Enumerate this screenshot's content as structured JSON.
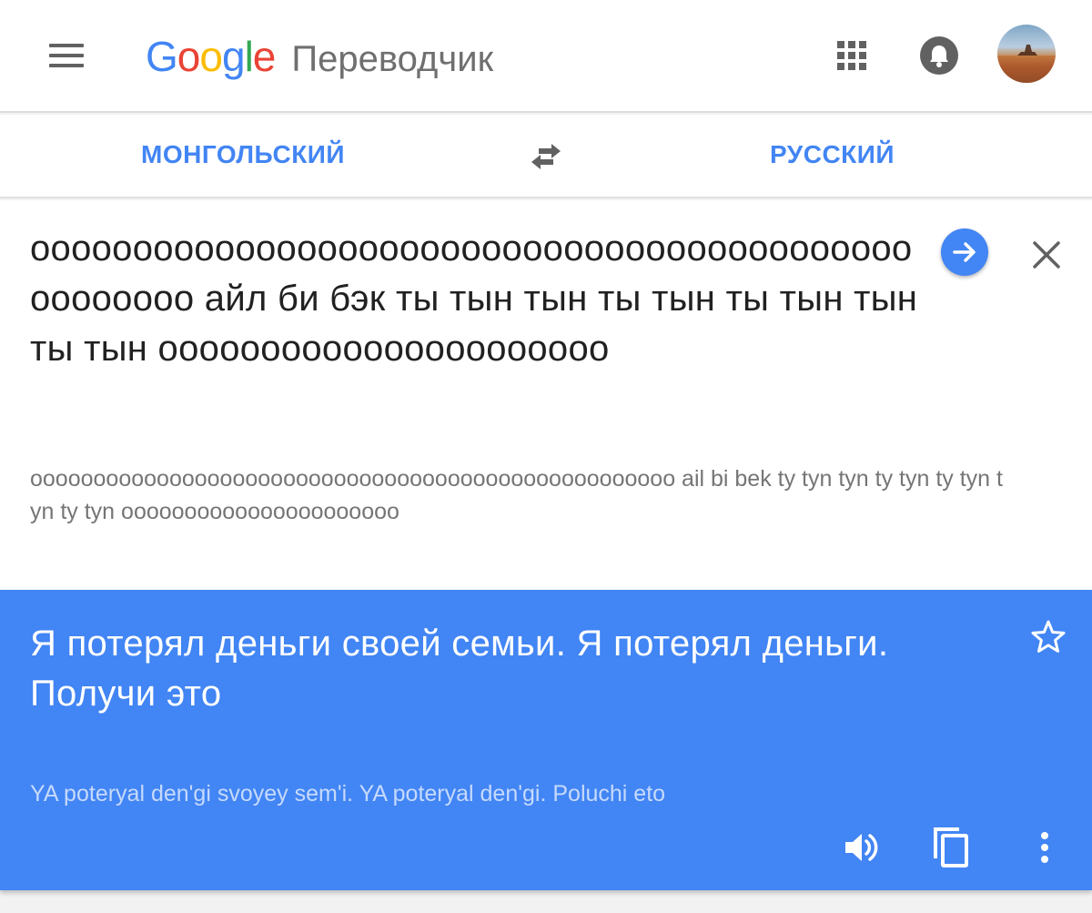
{
  "header": {
    "logo": {
      "letters": [
        "G",
        "o",
        "o",
        "g",
        "l",
        "e"
      ]
    },
    "app_title": "Переводчик",
    "icons": {
      "menu": "menu-icon",
      "apps": "apps-grid-icon",
      "notifications": "bell-icon",
      "avatar": "user-avatar"
    }
  },
  "languages": {
    "source": "МОНГОЛЬСКИЙ",
    "target": "РУССКИЙ",
    "swap_icon": "swap-arrows-icon"
  },
  "input": {
    "text": "ооооооооооооооооооооооооооооооооооооооооооооооооооо айл би бэк ты тын тын ты тын ты тын тын ты тын оооооооооооооооооооооо",
    "transliteration": "ooooooooooooooooooooooooooooooooooooooooooooooooooo ail bi bek ty tyn tyn ty tyn ty tyn tyn ty tyn oooooooooooooooooooooo"
  },
  "result": {
    "text": "Я потерял деньги своей семьи. Я потерял деньги. Получи это",
    "transliteration": "YA poteryal den'gi svoyey sem'i. YA poteryal den'gi. Poluchi eto",
    "icons": {
      "star": "star-outline-icon",
      "speaker": "speaker-icon",
      "copy": "copy-icon",
      "more": "more-vert-icon"
    }
  },
  "colors": {
    "accent": "#4285f4",
    "logo_blue": "#4285f4",
    "logo_red": "#ea4335",
    "logo_yellow": "#fbbc05",
    "logo_green": "#34a853",
    "result_bg": "#4285f4",
    "icon_gray": "#616161"
  }
}
